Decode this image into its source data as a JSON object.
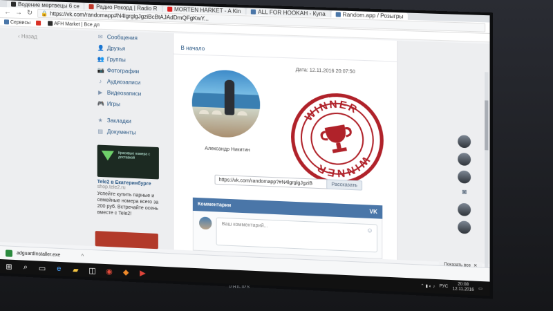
{
  "browser": {
    "tabs": [
      {
        "label": "Водение мертвецы 6 се",
        "color": "#2b2b2b"
      },
      {
        "label": "Радио Рекорд | Radio R",
        "color": "#c0392b"
      },
      {
        "label": "MORTEN HARKET - A Kin",
        "color": "#e02020"
      },
      {
        "label": "ALL FOR HOOKAH - Купа",
        "color": "#4a76a8"
      },
      {
        "label": "Random.app / Розыгры",
        "color": "#4a76a8"
      }
    ],
    "url": "https://vk.com/randomapp#N4lgrglgJgziBcBtAJAdDmQFgKwY...",
    "bookmarks": [
      {
        "label": "Сервисы",
        "color": "#4a76a8"
      },
      {
        "label": "",
        "color": "#d93025"
      },
      {
        "label": "AFH Market | Все дл",
        "color": "#2b2b2b"
      }
    ]
  },
  "page": {
    "back_label": "Назад",
    "nav": [
      {
        "icon": "message-icon",
        "glyph": "✉",
        "label": "Сообщения"
      },
      {
        "icon": "friends-icon",
        "glyph": "👤",
        "label": "Друзья"
      },
      {
        "icon": "groups-icon",
        "glyph": "👥",
        "label": "Группы"
      },
      {
        "icon": "camera-icon",
        "glyph": "📷",
        "label": "Фотографии"
      },
      {
        "icon": "music-icon",
        "glyph": "♪",
        "label": "Аудиозаписи"
      },
      {
        "icon": "video-icon",
        "glyph": "▶",
        "label": "Видеозаписи"
      },
      {
        "icon": "gamepad-icon",
        "glyph": "🎮",
        "label": "Игры"
      }
    ],
    "nav2": [
      {
        "icon": "star-icon",
        "glyph": "★",
        "label": "Закладки"
      },
      {
        "icon": "document-icon",
        "glyph": "▤",
        "label": "Документы"
      }
    ],
    "ad": {
      "image_text": "Красивые номера с доставкой",
      "title": "Tele2 в Екатеринбурге",
      "domain": "shop.tele2.ru",
      "body": "Успейте купить парные и семейные номера всего за 200 руб. Встречайте осень вместе с Tele2!"
    },
    "breadcrumb": "В начало",
    "date": "Дата: 12.11.2016 20:07:50",
    "winner_name": "Александр Никитин",
    "stamp_text": "WINNER",
    "share_url": "https://vk.com/randomapp?#N4lgrglgJgziB",
    "share_label": "Рассказать",
    "comments_label": "Комментарии",
    "vk_logo": "VK",
    "comment_placeholder": "Ваш комментарий...",
    "show_panel": "Показать все"
  },
  "download": {
    "file": "adguardInstaller.exe"
  },
  "taskbar": {
    "lang": "РУС",
    "time": "20:08",
    "date": "12.11.2016"
  },
  "monitor_brand": "PHILIPS"
}
